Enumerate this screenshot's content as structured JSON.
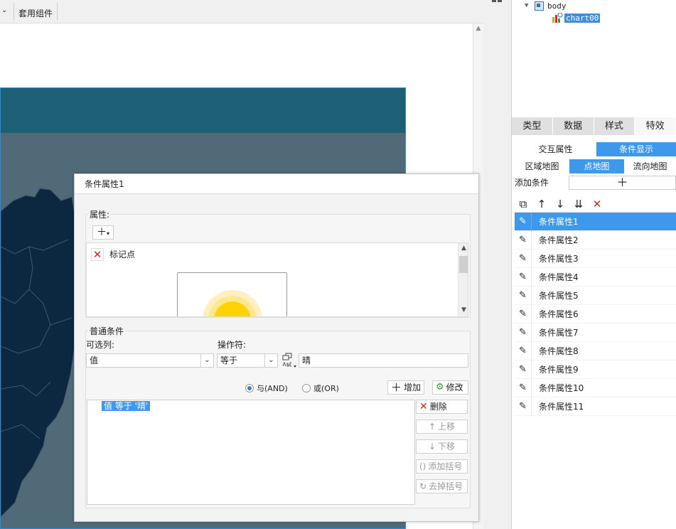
{
  "toolbar": {
    "suite_label": "套用组件"
  },
  "tree": {
    "body": "body",
    "chart": "chart00"
  },
  "tabs": [
    "类型",
    "数据",
    "样式",
    "特效"
  ],
  "panel": {
    "seg1": [
      "交互属性",
      "条件显示"
    ],
    "seg2": [
      "区域地图",
      "点地图",
      "流向地图"
    ],
    "add_condition_label": "添加条件",
    "conditions": [
      "条件属性1",
      "条件属性2",
      "条件属性3",
      "条件属性4",
      "条件属性5",
      "条件属性6",
      "条件属性7",
      "条件属性8",
      "条件属性9",
      "条件属性10",
      "条件属性11"
    ]
  },
  "dialog": {
    "title": "条件属性1",
    "attr_group_label": "属性:",
    "attr_item_label": "标记点",
    "cond_group_label": "普通条件",
    "col_label": "可选列:",
    "op_label": "操作符:",
    "col_value": "值",
    "op_value": "等于",
    "value_input": "晴",
    "radio_and": "与(AND)",
    "radio_or": "或(OR)",
    "btn_add": "增加",
    "btn_edit": "修改",
    "expr": "值 等于 '晴'",
    "btn_delete": "删除",
    "btn_up": "上移",
    "btn_down": "下移",
    "btn_add_paren": "添加括号",
    "btn_remove_paren": "去掉括号"
  },
  "colors": {
    "accent": "#3e98ec",
    "chart_title_bg": "#1d6076",
    "chart_bg": "#516a78",
    "map_fill": "#0b2840",
    "marker_sun": "#ffd200"
  }
}
